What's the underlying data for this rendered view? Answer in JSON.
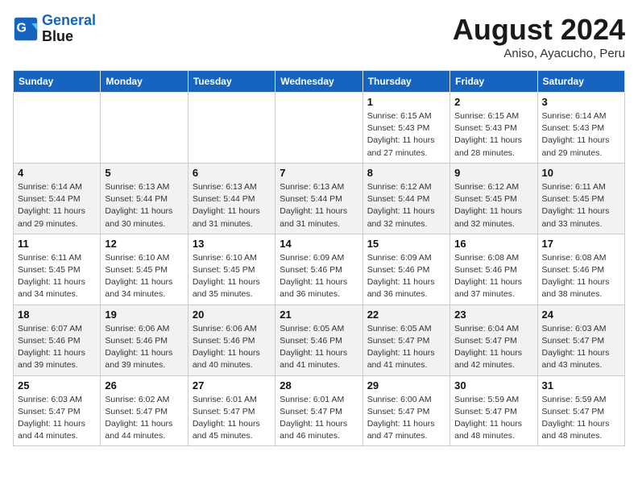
{
  "header": {
    "logo_line1": "General",
    "logo_line2": "Blue",
    "month_year": "August 2024",
    "location": "Aniso, Ayacucho, Peru"
  },
  "days_of_week": [
    "Sunday",
    "Monday",
    "Tuesday",
    "Wednesday",
    "Thursday",
    "Friday",
    "Saturday"
  ],
  "weeks": [
    [
      {
        "day": "",
        "detail": ""
      },
      {
        "day": "",
        "detail": ""
      },
      {
        "day": "",
        "detail": ""
      },
      {
        "day": "",
        "detail": ""
      },
      {
        "day": "1",
        "detail": "Sunrise: 6:15 AM\nSunset: 5:43 PM\nDaylight: 11 hours\nand 27 minutes."
      },
      {
        "day": "2",
        "detail": "Sunrise: 6:15 AM\nSunset: 5:43 PM\nDaylight: 11 hours\nand 28 minutes."
      },
      {
        "day": "3",
        "detail": "Sunrise: 6:14 AM\nSunset: 5:43 PM\nDaylight: 11 hours\nand 29 minutes."
      }
    ],
    [
      {
        "day": "4",
        "detail": "Sunrise: 6:14 AM\nSunset: 5:44 PM\nDaylight: 11 hours\nand 29 minutes."
      },
      {
        "day": "5",
        "detail": "Sunrise: 6:13 AM\nSunset: 5:44 PM\nDaylight: 11 hours\nand 30 minutes."
      },
      {
        "day": "6",
        "detail": "Sunrise: 6:13 AM\nSunset: 5:44 PM\nDaylight: 11 hours\nand 31 minutes."
      },
      {
        "day": "7",
        "detail": "Sunrise: 6:13 AM\nSunset: 5:44 PM\nDaylight: 11 hours\nand 31 minutes."
      },
      {
        "day": "8",
        "detail": "Sunrise: 6:12 AM\nSunset: 5:44 PM\nDaylight: 11 hours\nand 32 minutes."
      },
      {
        "day": "9",
        "detail": "Sunrise: 6:12 AM\nSunset: 5:45 PM\nDaylight: 11 hours\nand 32 minutes."
      },
      {
        "day": "10",
        "detail": "Sunrise: 6:11 AM\nSunset: 5:45 PM\nDaylight: 11 hours\nand 33 minutes."
      }
    ],
    [
      {
        "day": "11",
        "detail": "Sunrise: 6:11 AM\nSunset: 5:45 PM\nDaylight: 11 hours\nand 34 minutes."
      },
      {
        "day": "12",
        "detail": "Sunrise: 6:10 AM\nSunset: 5:45 PM\nDaylight: 11 hours\nand 34 minutes."
      },
      {
        "day": "13",
        "detail": "Sunrise: 6:10 AM\nSunset: 5:45 PM\nDaylight: 11 hours\nand 35 minutes."
      },
      {
        "day": "14",
        "detail": "Sunrise: 6:09 AM\nSunset: 5:46 PM\nDaylight: 11 hours\nand 36 minutes."
      },
      {
        "day": "15",
        "detail": "Sunrise: 6:09 AM\nSunset: 5:46 PM\nDaylight: 11 hours\nand 36 minutes."
      },
      {
        "day": "16",
        "detail": "Sunrise: 6:08 AM\nSunset: 5:46 PM\nDaylight: 11 hours\nand 37 minutes."
      },
      {
        "day": "17",
        "detail": "Sunrise: 6:08 AM\nSunset: 5:46 PM\nDaylight: 11 hours\nand 38 minutes."
      }
    ],
    [
      {
        "day": "18",
        "detail": "Sunrise: 6:07 AM\nSunset: 5:46 PM\nDaylight: 11 hours\nand 39 minutes."
      },
      {
        "day": "19",
        "detail": "Sunrise: 6:06 AM\nSunset: 5:46 PM\nDaylight: 11 hours\nand 39 minutes."
      },
      {
        "day": "20",
        "detail": "Sunrise: 6:06 AM\nSunset: 5:46 PM\nDaylight: 11 hours\nand 40 minutes."
      },
      {
        "day": "21",
        "detail": "Sunrise: 6:05 AM\nSunset: 5:46 PM\nDaylight: 11 hours\nand 41 minutes."
      },
      {
        "day": "22",
        "detail": "Sunrise: 6:05 AM\nSunset: 5:47 PM\nDaylight: 11 hours\nand 41 minutes."
      },
      {
        "day": "23",
        "detail": "Sunrise: 6:04 AM\nSunset: 5:47 PM\nDaylight: 11 hours\nand 42 minutes."
      },
      {
        "day": "24",
        "detail": "Sunrise: 6:03 AM\nSunset: 5:47 PM\nDaylight: 11 hours\nand 43 minutes."
      }
    ],
    [
      {
        "day": "25",
        "detail": "Sunrise: 6:03 AM\nSunset: 5:47 PM\nDaylight: 11 hours\nand 44 minutes."
      },
      {
        "day": "26",
        "detail": "Sunrise: 6:02 AM\nSunset: 5:47 PM\nDaylight: 11 hours\nand 44 minutes."
      },
      {
        "day": "27",
        "detail": "Sunrise: 6:01 AM\nSunset: 5:47 PM\nDaylight: 11 hours\nand 45 minutes."
      },
      {
        "day": "28",
        "detail": "Sunrise: 6:01 AM\nSunset: 5:47 PM\nDaylight: 11 hours\nand 46 minutes."
      },
      {
        "day": "29",
        "detail": "Sunrise: 6:00 AM\nSunset: 5:47 PM\nDaylight: 11 hours\nand 47 minutes."
      },
      {
        "day": "30",
        "detail": "Sunrise: 5:59 AM\nSunset: 5:47 PM\nDaylight: 11 hours\nand 48 minutes."
      },
      {
        "day": "31",
        "detail": "Sunrise: 5:59 AM\nSunset: 5:47 PM\nDaylight: 11 hours\nand 48 minutes."
      }
    ]
  ]
}
